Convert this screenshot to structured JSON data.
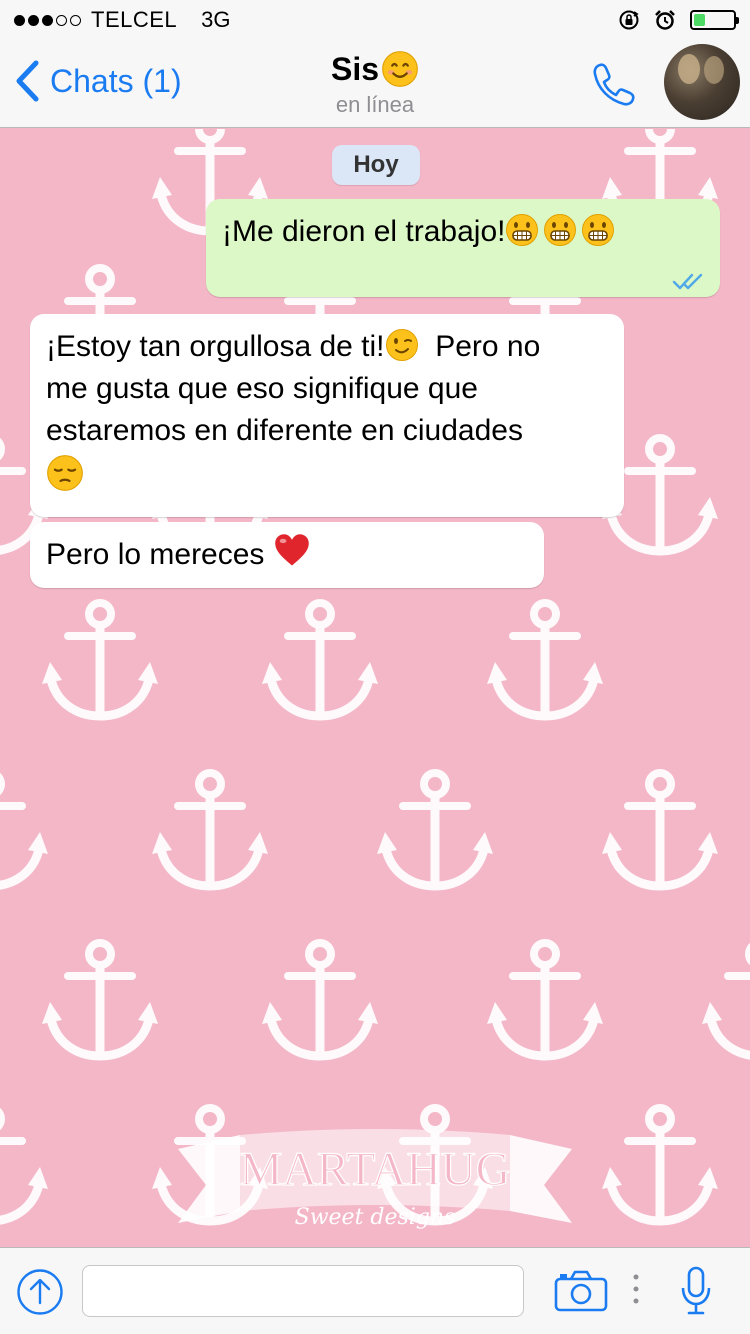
{
  "status_bar": {
    "signal_dots_filled": 3,
    "signal_dots_total": 5,
    "carrier": "TELCEL",
    "network": "3G",
    "battery_level": 0.3,
    "battery_color": "#4cd964"
  },
  "nav": {
    "back_label": "Chats (1)",
    "contact_name": "Sis",
    "contact_emoji": "smiling-face-icon",
    "status": "en línea",
    "accent_color": "#1b7cf2"
  },
  "chat": {
    "date_separator": "Hoy",
    "background_color": "#f4b7c8",
    "watermark": "MARTAHUG",
    "watermark_tagline": "Sweet designs",
    "messages": [
      {
        "direction": "out",
        "text": "¡Me dieron el trabajo!",
        "emojis": [
          "grinning-teeth-icon",
          "grinning-teeth-icon",
          "grinning-teeth-icon"
        ],
        "status": "read",
        "status_icon": "double-check-icon"
      },
      {
        "direction": "in",
        "text_line1": "¡Estoy tan orgullosa de ti!",
        "emoji_mid": "winking-face-icon",
        "text_line1b": "Pero no",
        "text_line2": "me gusta que eso signifique que",
        "text_line3": "estaremos en diferente en ciudades",
        "emoji_end": "pensive-face-icon"
      },
      {
        "direction": "in",
        "text": "Pero lo mereces",
        "emoji": "red-heart-icon"
      }
    ]
  },
  "input_bar": {
    "message_value": "",
    "placeholder": ""
  }
}
